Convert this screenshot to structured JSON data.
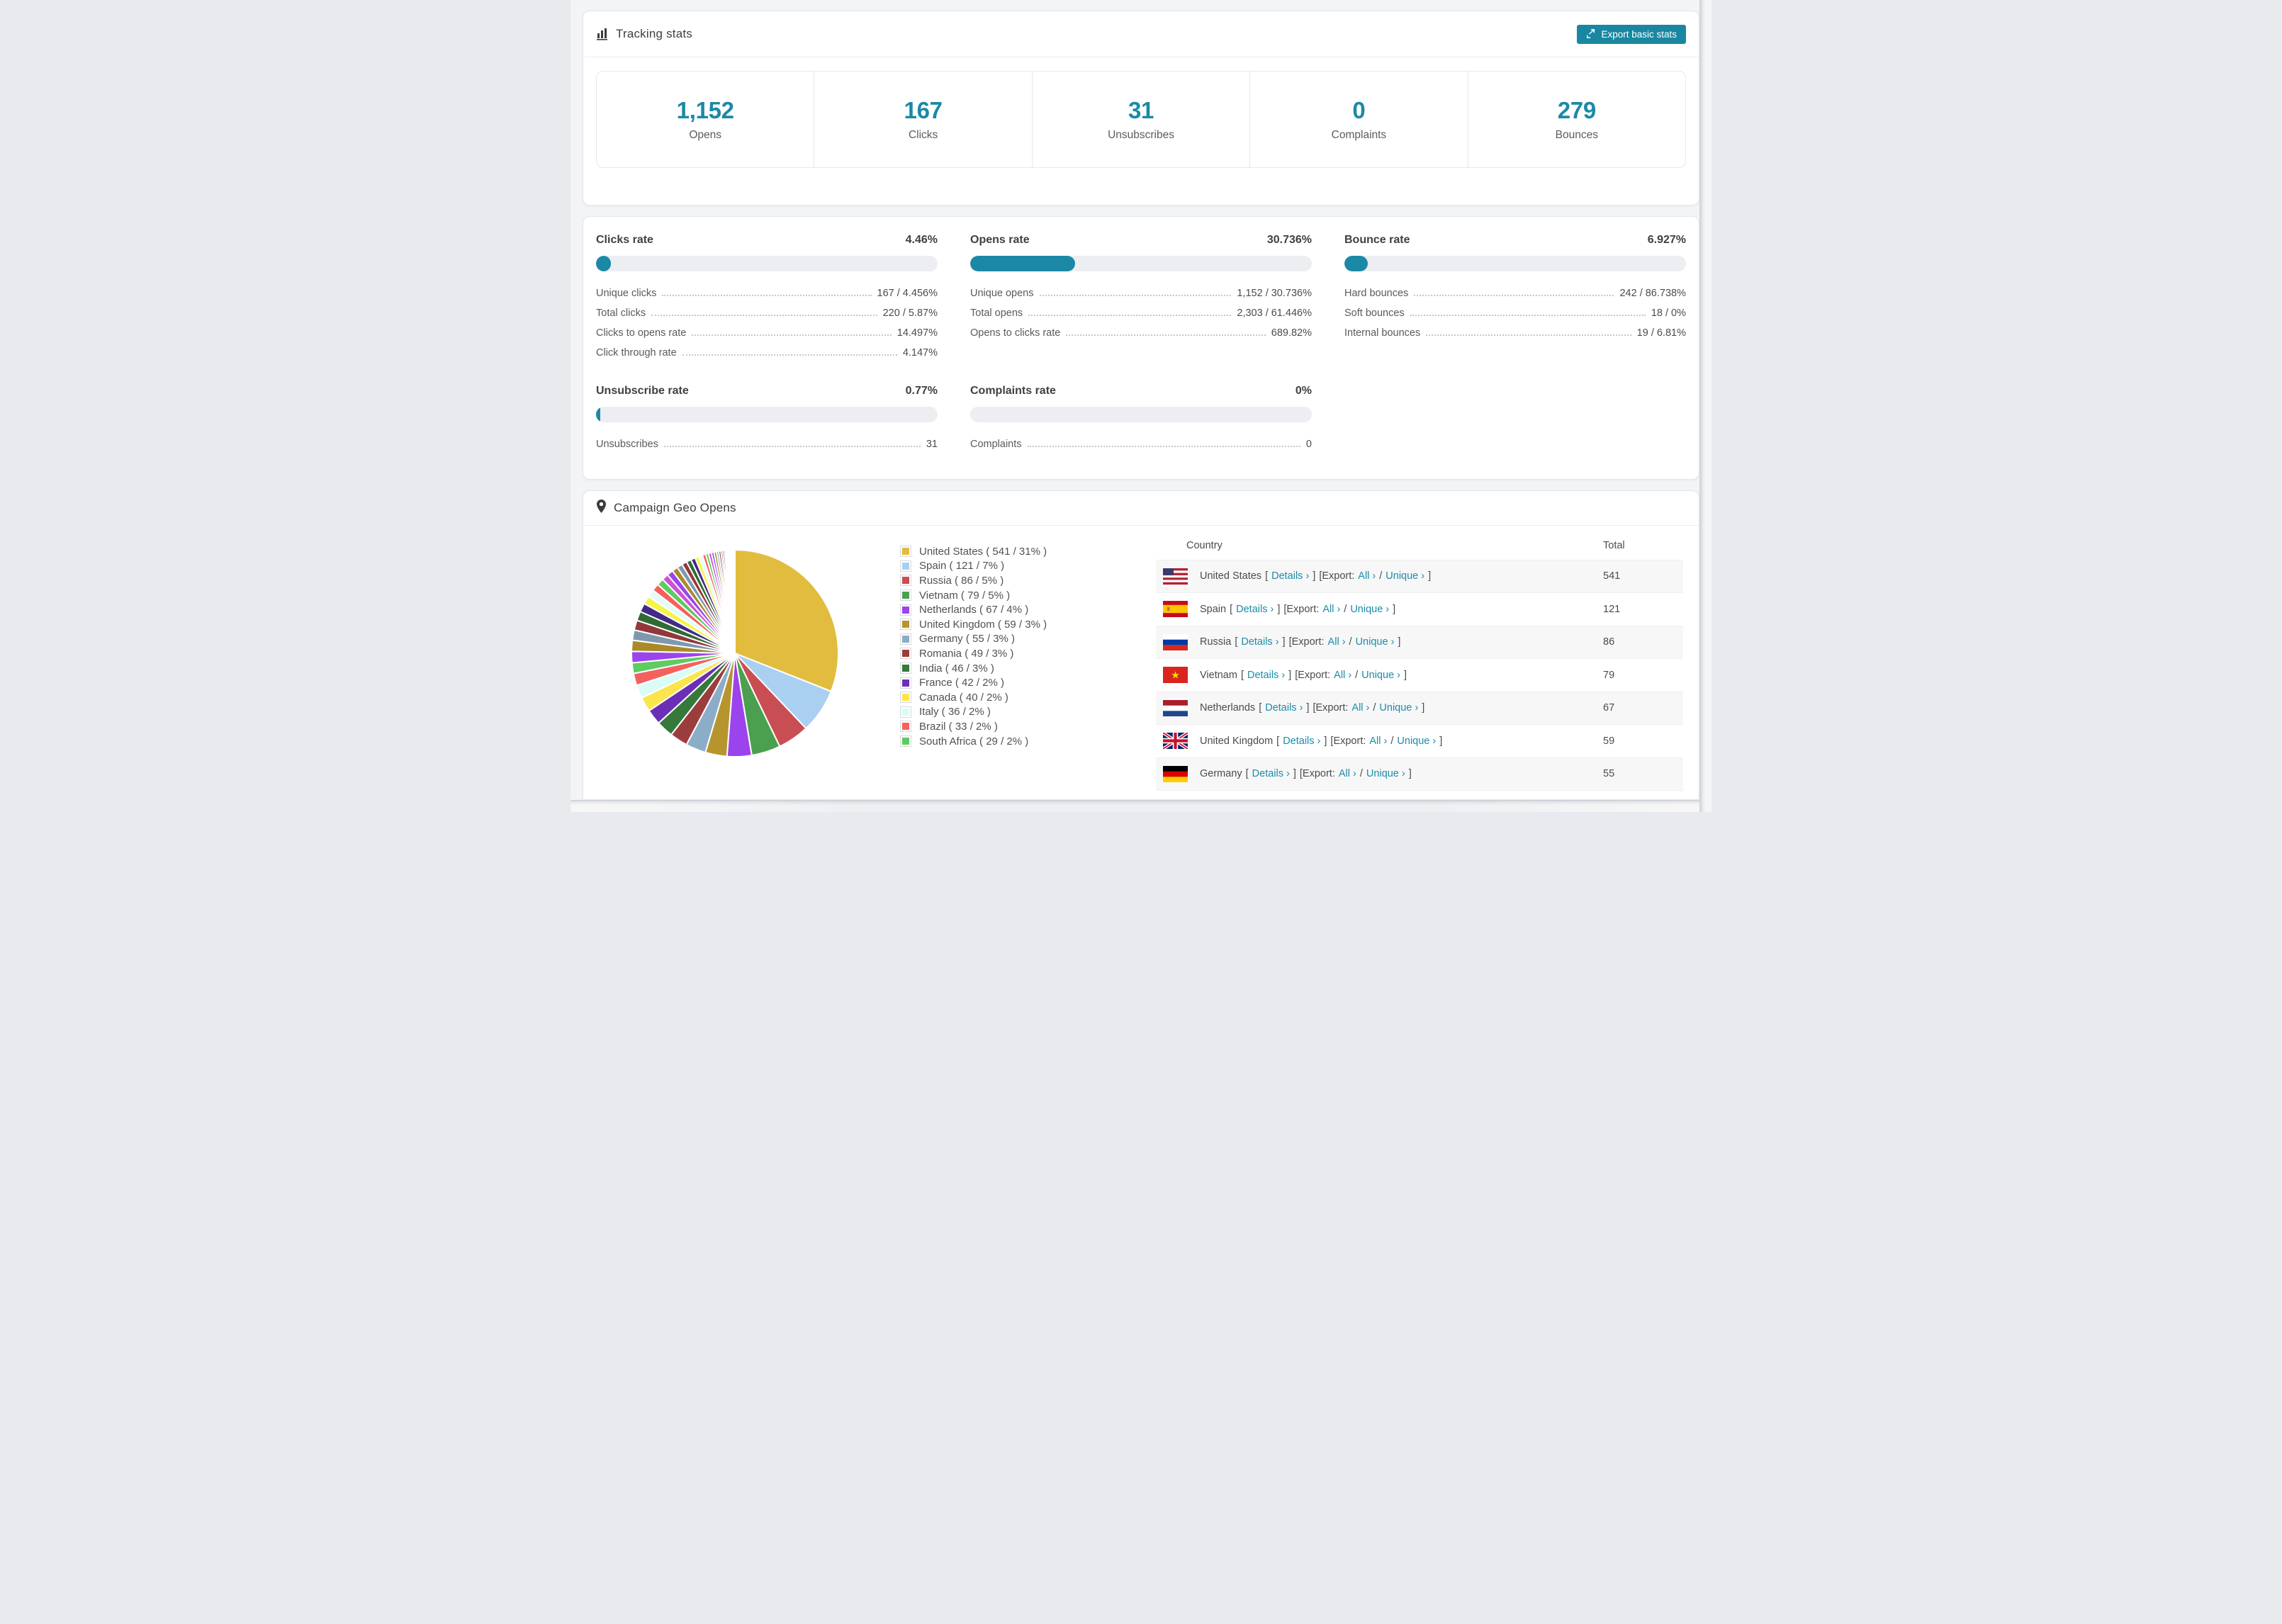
{
  "colors": {
    "accent_teal": "#1b89a6",
    "button_teal": "#1987a1",
    "link_teal": "#1b8ca8",
    "bar_track": "#eceef1",
    "page_bg": "#f3f4f6",
    "stripe_row": "#f7f7f8"
  },
  "tracking": {
    "title": "Tracking stats",
    "export_button": "Export basic stats",
    "stats": [
      {
        "value": "1,152",
        "label": "Opens"
      },
      {
        "value": "167",
        "label": "Clicks"
      },
      {
        "value": "31",
        "label": "Unsubscribes"
      },
      {
        "value": "0",
        "label": "Complaints"
      },
      {
        "value": "279",
        "label": "Bounces"
      }
    ]
  },
  "rates": {
    "sections": [
      {
        "title": "Clicks rate",
        "value": "4.46%",
        "percent": 4.46,
        "col": 1,
        "rows": [
          [
            "Unique clicks",
            "167 / 4.456%"
          ],
          [
            "Total clicks",
            "220 / 5.87%"
          ],
          [
            "Clicks to opens rate",
            "14.497%"
          ],
          [
            "Click through rate",
            "4.147%"
          ]
        ]
      },
      {
        "title": "Opens rate",
        "value": "30.736%",
        "percent": 30.736,
        "col": 2,
        "rows": [
          [
            "Unique opens",
            "1,152 / 30.736%"
          ],
          [
            "Total opens",
            "2,303 / 61.446%"
          ],
          [
            "Opens to clicks rate",
            "689.82%"
          ]
        ]
      },
      {
        "title": "Bounce rate",
        "value": "6.927%",
        "percent": 6.927,
        "col": 3,
        "rows": [
          [
            "Hard bounces",
            "242 / 86.738%"
          ],
          [
            "Soft bounces",
            "18 / 0%"
          ],
          [
            "Internal bounces",
            "19 / 6.81%"
          ]
        ]
      },
      {
        "title": "Unsubscribe rate",
        "value": "0.77%",
        "percent": 0.77,
        "col": 1,
        "rows": [
          [
            "Unsubscribes",
            "31"
          ]
        ]
      },
      {
        "title": "Complaints rate",
        "value": "0%",
        "percent": 0,
        "col": 2,
        "rows": [
          [
            "Complaints",
            "0"
          ]
        ]
      }
    ]
  },
  "geo": {
    "title": "Campaign Geo Opens",
    "table": {
      "columns": [
        "Country",
        "Total"
      ],
      "labels": {
        "details": "Details ›",
        "export_prefix": "[Export:",
        "all": "All ›",
        "slash": "/",
        "unique": "Unique ›",
        "open_bracket": "[",
        "close_bracket": "]"
      },
      "rows": [
        {
          "country": "United States",
          "flag": "us",
          "total": "541"
        },
        {
          "country": "Spain",
          "flag": "es",
          "total": "121"
        },
        {
          "country": "Russia",
          "flag": "ru",
          "total": "86"
        },
        {
          "country": "Vietnam",
          "flag": "vn",
          "total": "79"
        },
        {
          "country": "Netherlands",
          "flag": "nl",
          "total": "67"
        },
        {
          "country": "United Kingdom",
          "flag": "gb",
          "total": "59"
        },
        {
          "country": "Germany",
          "flag": "de",
          "total": "55"
        }
      ]
    }
  },
  "chart_data": {
    "type": "pie",
    "title": "Campaign Geo Opens",
    "legend_position": "right",
    "start_angle_deg": -90,
    "direction": "clockwise",
    "slices": [
      {
        "label": "United States",
        "value": 541,
        "pct": "31%",
        "color": "#e2bc3f"
      },
      {
        "label": "Spain",
        "value": 121,
        "pct": "7%",
        "color": "#a9cff1"
      },
      {
        "label": "Russia",
        "value": 86,
        "pct": "5%",
        "color": "#c94e53"
      },
      {
        "label": "Vietnam",
        "value": 79,
        "pct": "5%",
        "color": "#4ba04f"
      },
      {
        "label": "Netherlands",
        "value": 67,
        "pct": "4%",
        "color": "#9b44ed"
      },
      {
        "label": "United Kingdom",
        "value": 59,
        "pct": "3%",
        "color": "#b6952f"
      },
      {
        "label": "Germany",
        "value": 55,
        "pct": "3%",
        "color": "#8cadc8"
      },
      {
        "label": "Romania",
        "value": 49,
        "pct": "3%",
        "color": "#9c3d3d"
      },
      {
        "label": "India",
        "value": 46,
        "pct": "3%",
        "color": "#35793b"
      },
      {
        "label": "France",
        "value": 42,
        "pct": "2%",
        "color": "#6a2fb5"
      },
      {
        "label": "Canada",
        "value": 40,
        "pct": "2%",
        "color": "#fbe54d"
      },
      {
        "label": "Italy",
        "value": 36,
        "pct": "2%",
        "color": "#d9fcf6"
      },
      {
        "label": "Brazil",
        "value": 33,
        "pct": "2%",
        "color": "#f4605e"
      },
      {
        "label": "South Africa",
        "value": 29,
        "pct": "2%",
        "color": "#5ecb63"
      }
    ],
    "others": {
      "note": "remaining small unlabeled slices",
      "values": [
        31,
        30,
        28,
        27,
        25,
        24,
        22,
        21,
        20,
        19,
        18,
        17,
        16,
        15,
        14,
        13,
        12,
        11,
        10,
        9,
        8,
        8,
        7,
        7,
        6,
        6,
        5,
        5,
        4,
        4,
        3,
        3,
        2,
        2,
        2,
        1,
        1,
        1,
        1,
        1,
        1,
        1,
        1
      ],
      "color_cycle": [
        "#9b44ed",
        "#a98a2b",
        "#7e99af",
        "#93383a",
        "#2f6b33",
        "#432a86",
        "#f6f34a",
        "#e4fbf7",
        "#f4605e",
        "#5ecb63",
        "#cf4fd8"
      ]
    }
  }
}
